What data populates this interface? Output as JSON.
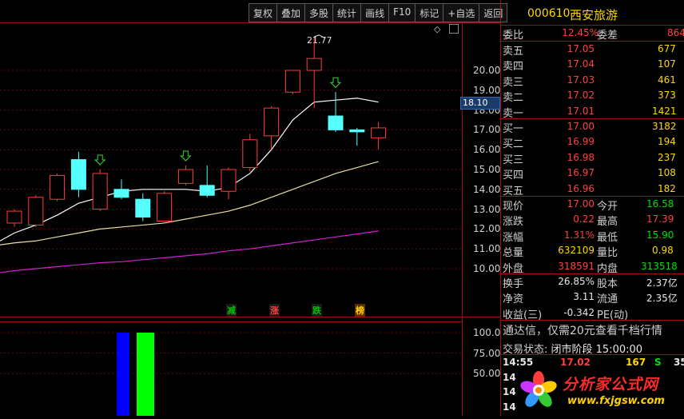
{
  "toolbar": {
    "buttons": [
      "复权",
      "叠加",
      "多股",
      "统计",
      "画线",
      "F10",
      "标记",
      "+自选",
      "返回"
    ]
  },
  "price_axis": [
    "20.00",
    "19.00",
    "18.00",
    "17.00",
    "16.00",
    "15.00",
    "14.00",
    "13.00",
    "12.00",
    "11.00",
    "10.00"
  ],
  "current_price_tag": "18.10",
  "high_annotation": "21.77",
  "event_markers": [
    "减",
    "涨",
    "跌",
    "榜"
  ],
  "volume_axis": [
    "100.0",
    "75.00",
    "50.00"
  ],
  "quote": {
    "code": "000610",
    "name": "西安旅游",
    "weibi_label": "委比",
    "weibi_value": "12.45%",
    "weicha_label": "委差",
    "weicha_value": "864",
    "sell": [
      {
        "label": "卖五",
        "price": "17.05",
        "vol": "677"
      },
      {
        "label": "卖四",
        "price": "17.04",
        "vol": "107"
      },
      {
        "label": "卖三",
        "price": "17.03",
        "vol": "461"
      },
      {
        "label": "卖二",
        "price": "17.02",
        "vol": "373"
      },
      {
        "label": "卖一",
        "price": "17.01",
        "vol": "1421"
      }
    ],
    "buy": [
      {
        "label": "买一",
        "price": "17.00",
        "vol": "3182"
      },
      {
        "label": "买二",
        "price": "16.99",
        "vol": "194"
      },
      {
        "label": "买三",
        "price": "16.98",
        "vol": "237"
      },
      {
        "label": "买四",
        "price": "16.97",
        "vol": "108"
      },
      {
        "label": "买五",
        "price": "16.96",
        "vol": "182"
      }
    ],
    "stats": [
      {
        "l1": "现价",
        "v1": "17.00",
        "l2": "今开",
        "v2": "16.58"
      },
      {
        "l1": "涨跌",
        "v1": "0.22",
        "l2": "最高",
        "v2": "17.39"
      },
      {
        "l1": "涨幅",
        "v1": "1.31%",
        "l2": "最低",
        "v2": "15.90"
      },
      {
        "l1": "总量",
        "v1": "632109",
        "l2": "量比",
        "v2": "0.98"
      },
      {
        "l1": "外盘",
        "v1": "318591",
        "l2": "内盘",
        "v2": "313518"
      }
    ],
    "fin": [
      {
        "l1": "换手",
        "v1": "26.85%",
        "l2": "股本",
        "v2": "2.37亿"
      },
      {
        "l1": "净资",
        "v1": "3.11",
        "l2": "流通",
        "v2": "2.35亿"
      },
      {
        "l1": "收益(三)",
        "v1": "-0.342",
        "l2": "PE(动)",
        "v2": ""
      }
    ],
    "notice": "通达信，仅需20元查看千档行情",
    "status_label": "交易状态:",
    "status_value": "闭市阶段 15:00:00",
    "ticks": [
      {
        "time": "14:55",
        "price": "17.02",
        "vol": "167",
        "side": "S",
        "extra": "35"
      },
      {
        "time": "14",
        "price": "",
        "vol": "",
        "side": "",
        "extra": ""
      },
      {
        "time": "14",
        "price": "",
        "vol": "",
        "side": "",
        "extra": ""
      },
      {
        "time": "14",
        "price": "",
        "vol": "",
        "side": "",
        "extra": ""
      }
    ]
  },
  "watermark": {
    "title": "分析家公式网",
    "url": "www.fxjgsw.com"
  },
  "chart_data": {
    "type": "candlestick",
    "ylim": [
      9.0,
      22.0
    ],
    "candles": [
      {
        "o": 12.3,
        "c": 12.9,
        "h": 13.0,
        "l": 12.1,
        "up": true
      },
      {
        "o": 12.2,
        "c": 13.6,
        "h": 13.7,
        "l": 12.1,
        "up": true
      },
      {
        "o": 13.5,
        "c": 14.7,
        "h": 14.8,
        "l": 13.4,
        "up": true
      },
      {
        "o": 15.5,
        "c": 14.0,
        "h": 15.9,
        "l": 13.6,
        "up": false
      },
      {
        "o": 13.0,
        "c": 14.8,
        "h": 15.0,
        "l": 12.9,
        "up": true
      },
      {
        "o": 14.0,
        "c": 13.6,
        "h": 14.5,
        "l": 13.5,
        "up": false
      },
      {
        "o": 13.5,
        "c": 12.6,
        "h": 13.8,
        "l": 12.4,
        "up": false
      },
      {
        "o": 12.4,
        "c": 13.8,
        "h": 13.9,
        "l": 12.4,
        "up": true
      },
      {
        "o": 14.3,
        "c": 15.0,
        "h": 15.2,
        "l": 14.2,
        "up": true
      },
      {
        "o": 14.2,
        "c": 13.7,
        "h": 15.2,
        "l": 13.6,
        "up": false
      },
      {
        "o": 13.9,
        "c": 15.0,
        "h": 15.1,
        "l": 13.5,
        "up": true
      },
      {
        "o": 15.1,
        "c": 16.5,
        "h": 16.8,
        "l": 14.9,
        "up": true
      },
      {
        "o": 16.7,
        "c": 18.1,
        "h": 18.2,
        "l": 16.0,
        "up": true
      },
      {
        "o": 18.9,
        "c": 20.0,
        "h": 20.0,
        "l": 18.8,
        "up": true
      },
      {
        "o": 20.0,
        "c": 20.6,
        "h": 21.7,
        "l": 18.1,
        "up": true
      },
      {
        "o": 17.7,
        "c": 17.0,
        "h": 18.9,
        "l": 16.9,
        "up": false
      },
      {
        "o": 17.0,
        "c": 16.9,
        "h": 17.1,
        "l": 16.2,
        "up": false
      },
      {
        "o": 16.6,
        "c": 17.1,
        "h": 17.4,
        "l": 16.0,
        "up": true
      }
    ],
    "arrows_at": [
      4,
      8,
      15
    ],
    "ma_fast": [
      11.8,
      12.2,
      12.7,
      13.3,
      13.6,
      13.9,
      14.0,
      14.0,
      14.0,
      13.9,
      14.1,
      14.8,
      16.0,
      17.5,
      18.4,
      18.5,
      18.6,
      18.4
    ],
    "ma_slow": [
      11.3,
      11.4,
      11.6,
      11.8,
      12.0,
      12.1,
      12.2,
      12.3,
      12.5,
      12.7,
      12.9,
      13.2,
      13.6,
      14.0,
      14.4,
      14.8,
      15.1,
      15.4
    ],
    "ma_long": [
      9.9,
      10.0,
      10.1,
      10.2,
      10.3,
      10.35,
      10.45,
      10.55,
      10.65,
      10.75,
      10.9,
      11.0,
      11.15,
      11.3,
      11.45,
      11.6,
      11.75,
      11.9
    ],
    "volume": [
      {
        "index": 5,
        "value": 100,
        "color": "#0000ff"
      },
      {
        "index": 6,
        "value": 100,
        "color": "#00ff00"
      }
    ],
    "volume_ylim": [
      0,
      120
    ]
  }
}
